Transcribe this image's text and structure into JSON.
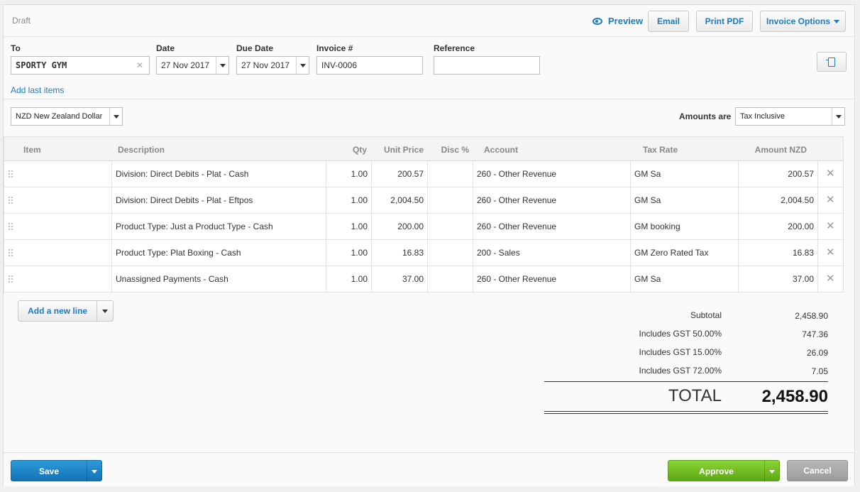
{
  "header": {
    "status": "Draft",
    "preview_label": "Preview",
    "email_label": "Email",
    "print_pdf_label": "Print PDF",
    "invoice_options_label": "Invoice Options"
  },
  "form": {
    "to_label": "To",
    "to_value": "SPORTY GYM",
    "date_label": "Date",
    "date_value": "27 Nov 2017",
    "due_date_label": "Due Date",
    "due_date_value": "27 Nov 2017",
    "invoice_no_label": "Invoice #",
    "invoice_no_value": "INV-0006",
    "reference_label": "Reference",
    "reference_value": "",
    "add_last_items": "Add last items"
  },
  "currency": {
    "value": "NZD New Zealand Dollar"
  },
  "amounts": {
    "label": "Amounts are",
    "value": "Tax Inclusive"
  },
  "table": {
    "headers": {
      "item": "Item",
      "description": "Description",
      "qty": "Qty",
      "unit_price": "Unit Price",
      "disc": "Disc %",
      "account": "Account",
      "tax_rate": "Tax Rate",
      "amount": "Amount NZD"
    },
    "rows": [
      {
        "item": "",
        "description": "Division: Direct Debits - Plat - Cash",
        "qty": "1.00",
        "unit_price": "200.57",
        "disc": "",
        "account": "260 - Other Revenue",
        "tax_rate": "GM Sa",
        "amount": "200.57"
      },
      {
        "item": "",
        "description": "Division: Direct Debits - Plat - Eftpos",
        "qty": "1.00",
        "unit_price": "2,004.50",
        "disc": "",
        "account": "260 - Other Revenue",
        "tax_rate": "GM Sa",
        "amount": "2,004.50"
      },
      {
        "item": "",
        "description": "Product Type: Just a Product Type - Cash",
        "qty": "1.00",
        "unit_price": "200.00",
        "disc": "",
        "account": "260 - Other Revenue",
        "tax_rate": "GM booking",
        "amount": "200.00"
      },
      {
        "item": "",
        "description": "Product Type: Plat Boxing - Cash",
        "qty": "1.00",
        "unit_price": "16.83",
        "disc": "",
        "account": "200 - Sales",
        "tax_rate": "GM Zero Rated Tax",
        "amount": "16.83"
      },
      {
        "item": "",
        "description": "Unassigned Payments - Cash",
        "qty": "1.00",
        "unit_price": "37.00",
        "disc": "",
        "account": "260 - Other Revenue",
        "tax_rate": "GM Sa",
        "amount": "37.00"
      }
    ]
  },
  "add_line_label": "Add a new line",
  "totals": {
    "subtotal_label": "Subtotal",
    "subtotal_value": "2,458.90",
    "gst": [
      {
        "label": "Includes GST 50.00%",
        "value": "747.36"
      },
      {
        "label": "Includes GST 15.00%",
        "value": "26.09"
      },
      {
        "label": "Includes GST 72.00%",
        "value": "7.05"
      }
    ],
    "total_label": "TOTAL",
    "total_value": "2,458.90"
  },
  "footer": {
    "save_label": "Save",
    "approve_label": "Approve",
    "cancel_label": "Cancel"
  }
}
